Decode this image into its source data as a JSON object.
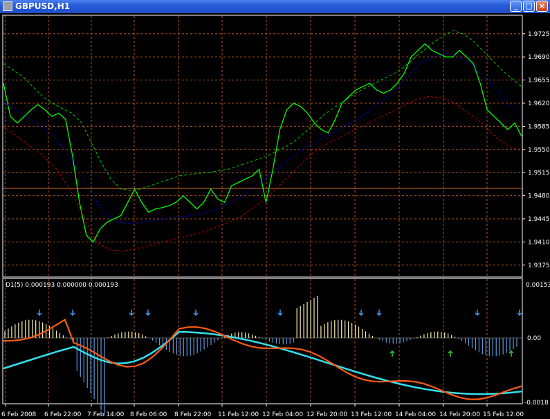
{
  "window": {
    "title": "GBPUSD,H1",
    "minimize_glyph": "_",
    "maximize_glyph": "□",
    "close_glyph": "×",
    "icon": "chart-window-icon"
  },
  "colors": {
    "background": "#000000",
    "grid": "#b3561d",
    "price_line": "#00ff00",
    "upper_band": "#00c800",
    "middle_band": "#0000cc",
    "lower_band": "#c80000",
    "osc_cyan": "#33e0ee",
    "osc_orange": "#ff5a14",
    "hist_pos": "#fff0b0",
    "hist_neg": "#5a9be0",
    "axis_text": "#ffffff"
  },
  "main_chart": {
    "price_axis": [
      "1.9725",
      "1.9690",
      "1.9655",
      "1.9620",
      "1.9585",
      "1.9550",
      "1.9515",
      "1.9480",
      "1.9445",
      "1.9410",
      "1.9375"
    ],
    "ylim": [
      1.9358,
      1.9752
    ],
    "horizontal_level": 1.9491
  },
  "indicator": {
    "label": "D1(5) 0.000193 0.000000 0.000193",
    "axis_top": "0.00153",
    "axis_zero": "0.00",
    "axis_bottom": "-0.0018"
  },
  "time_axis": [
    "6 Feb 2008",
    "6 Feb 22:00",
    "7 Feb 14:00",
    "8 Feb 06:00",
    "8 Feb 22:00",
    "11 Feb 12:00",
    "12 Feb 04:00",
    "12 Feb 20:00",
    "13 Feb 12:00",
    "14 Feb 04:00",
    "14 Feb 20:00",
    "15 Feb 12:00"
  ],
  "chart_data": {
    "type": "line",
    "ylim": [
      1.9358,
      1.9752
    ],
    "series": [
      {
        "values": [
          1.965,
          1.96,
          1.959,
          1.96,
          1.961,
          1.9618,
          1.961,
          1.96,
          1.9605,
          1.9595,
          1.954,
          1.947,
          1.942,
          1.941,
          1.943,
          1.944,
          1.9445,
          1.945,
          1.947,
          1.949,
          1.947,
          1.9455,
          1.946,
          1.9462,
          1.9465,
          1.947,
          1.948,
          1.947,
          1.946,
          1.947,
          1.949,
          1.9475,
          1.947,
          1.9495,
          1.95,
          1.9505,
          1.951,
          1.952,
          1.947,
          1.952,
          1.958,
          1.961,
          1.962,
          1.9615,
          1.9605,
          1.959,
          1.958,
          1.9575,
          1.9595,
          1.962,
          1.963,
          1.964,
          1.9645,
          1.965,
          1.964,
          1.9635,
          1.964,
          1.965,
          1.9665,
          1.969,
          1.97,
          1.971,
          1.97,
          1.9695,
          1.969,
          1.969,
          1.97,
          1.969,
          1.968,
          1.965,
          1.961,
          1.96,
          1.959,
          1.958,
          1.959,
          1.957
        ]
      },
      {
        "values": [
          1.968,
          1.967,
          1.966,
          1.9645,
          1.963,
          1.962,
          1.9612,
          1.9605,
          1.959,
          1.956,
          1.953,
          1.9505,
          1.949,
          1.9488,
          1.949,
          1.9495,
          1.95,
          1.9505,
          1.951,
          1.9512,
          1.9514,
          1.9515,
          1.9518,
          1.952,
          1.9525,
          1.953,
          1.9535,
          1.954,
          1.9548,
          1.9555,
          1.9565,
          1.9578,
          1.9592,
          1.9605,
          1.9615,
          1.9625,
          1.9635,
          1.9643,
          1.965,
          1.9658,
          1.9665,
          1.9675,
          1.9688,
          1.97,
          1.9712,
          1.9722,
          1.973,
          1.9725,
          1.9715,
          1.97,
          1.9685,
          1.967,
          1.9657,
          1.9645
        ]
      },
      {
        "values": [
          1.962,
          1.961,
          1.9598,
          1.9585,
          1.957,
          1.9545,
          1.9515,
          1.948,
          1.9455,
          1.944,
          1.9438,
          1.944,
          1.9443,
          1.9446,
          1.9448,
          1.945,
          1.9455,
          1.946,
          1.947,
          1.9482,
          1.9495,
          1.951,
          1.9525,
          1.954,
          1.9555,
          1.9565,
          1.9575,
          1.9585,
          1.9595,
          1.9608,
          1.9625,
          1.964,
          1.966,
          1.968,
          1.969,
          1.9695,
          1.969,
          1.968,
          1.966,
          1.964,
          1.962,
          1.9605
        ]
      },
      {
        "values": [
          1.9585,
          1.957,
          1.9555,
          1.954,
          1.952,
          1.949,
          1.945,
          1.941,
          1.9398,
          1.9396,
          1.94,
          1.9405,
          1.941,
          1.9415,
          1.942,
          1.9425,
          1.9432,
          1.944,
          1.945,
          1.9465,
          1.948,
          1.95,
          1.952,
          1.954,
          1.9555,
          1.9565,
          1.9575,
          1.9585,
          1.9595,
          1.9605,
          1.9615,
          1.9625,
          1.963,
          1.9628,
          1.962,
          1.9605,
          1.959,
          1.957,
          1.9555,
          1.9548
        ]
      }
    ]
  }
}
